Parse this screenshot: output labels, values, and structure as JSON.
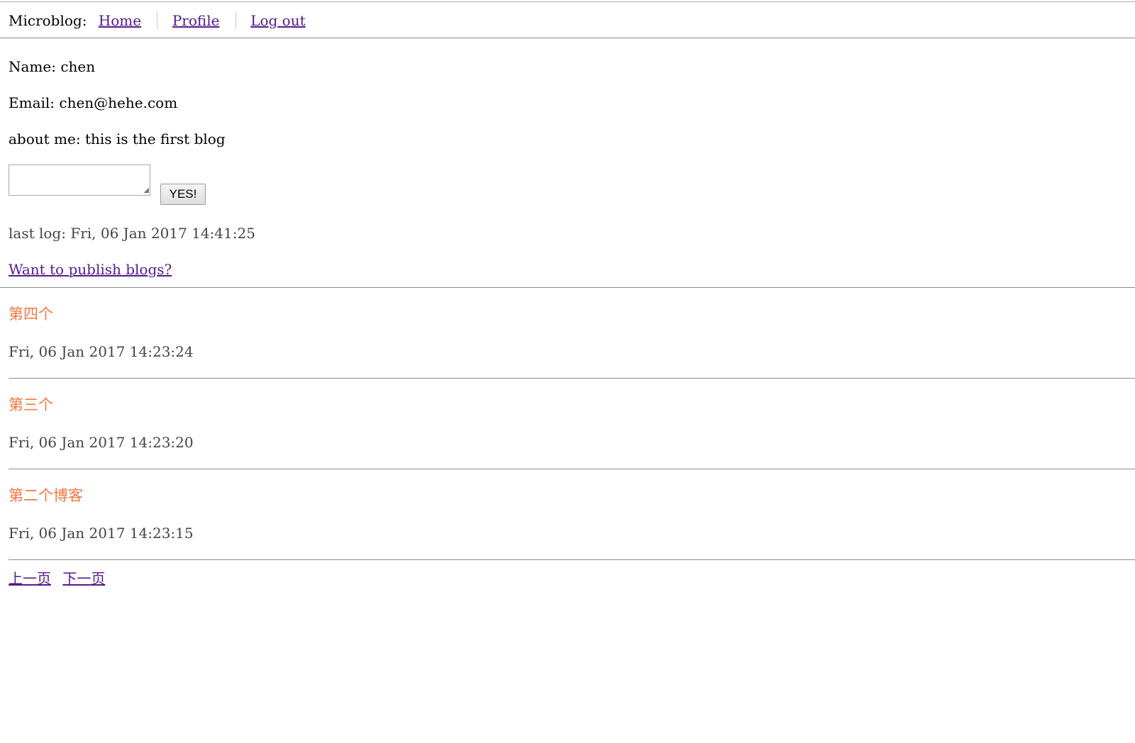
{
  "nav": {
    "brand": "Microblog:",
    "links": [
      "Home",
      "Profile",
      "Log out"
    ]
  },
  "profile": {
    "name": "Name: chen",
    "email": "Email: chen@hehe.com",
    "about": "about me: this is the first blog"
  },
  "form": {
    "input_value": "",
    "button_label": "YES!"
  },
  "last_log": "last log: Fri, 06 Jan 2017 14:41:25",
  "publish_link": "Want to publish blogs?",
  "posts": [
    {
      "title": "第四个",
      "time": "Fri, 06 Jan 2017 14:23:24"
    },
    {
      "title": "第三个",
      "time": "Fri, 06 Jan 2017 14:23:20"
    },
    {
      "title": "第二个博客",
      "time": "Fri, 06 Jan 2017 14:23:15"
    }
  ],
  "pagination": {
    "prev": "上一页",
    "next": "下一页"
  },
  "colors": {
    "link": "#551a8b",
    "post_title": "#f07845"
  }
}
